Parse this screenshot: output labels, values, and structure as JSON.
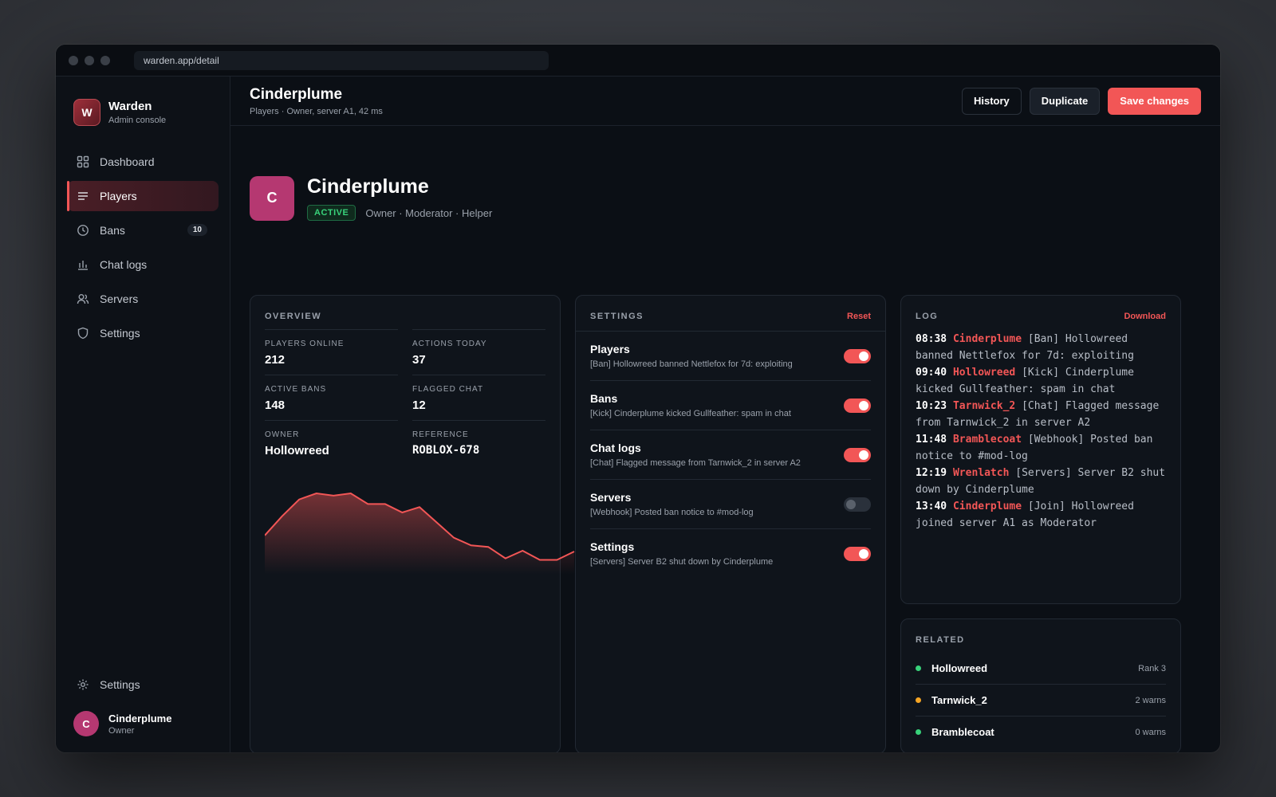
{
  "browser": {
    "url": "warden.app/detail"
  },
  "brand": {
    "logo_letter": "W",
    "name": "Warden",
    "subtitle": "Admin console"
  },
  "sidebar": {
    "items": [
      {
        "label": "Dashboard",
        "icon": "grid-icon"
      },
      {
        "label": "Players",
        "icon": "list-icon",
        "active": true
      },
      {
        "label": "Bans",
        "icon": "clock-icon",
        "badge": "10"
      },
      {
        "label": "Chat logs",
        "icon": "bar-chart-icon"
      },
      {
        "label": "Servers",
        "icon": "users-icon"
      },
      {
        "label": "Settings",
        "icon": "shield-icon"
      }
    ],
    "bottom_settings": "Settings",
    "user": {
      "initial": "C",
      "name": "Cinderplume",
      "role": "Owner"
    }
  },
  "header": {
    "title": "Cinderplume",
    "subtitle": "Players · Owner, server A1, 42 ms",
    "history_label": "History",
    "duplicate_label": "Duplicate",
    "save_label": "Save changes"
  },
  "profile": {
    "initial": "C",
    "name": "Cinderplume",
    "status": "ACTIVE",
    "roles": "Owner · Moderator · Helper"
  },
  "overview": {
    "heading": "OVERVIEW",
    "stats": [
      {
        "label": "PLAYERS ONLINE",
        "value": "212"
      },
      {
        "label": "ACTIONS TODAY",
        "value": "37"
      },
      {
        "label": "ACTIVE BANS",
        "value": "148"
      },
      {
        "label": "FLAGGED CHAT",
        "value": "12"
      },
      {
        "label": "OWNER",
        "value": "Hollowreed"
      },
      {
        "label": "REFERENCE",
        "value": "ROBLOX-678"
      }
    ],
    "sparkline": [
      0.45,
      0.7,
      0.92,
      1.0,
      0.97,
      1.0,
      0.86,
      0.86,
      0.75,
      0.82,
      0.62,
      0.42,
      0.32,
      0.3,
      0.15,
      0.25,
      0.13,
      0.13,
      0.24
    ]
  },
  "settings": {
    "heading": "SETTINGS",
    "reset_label": "Reset",
    "rows": [
      {
        "title": "Players",
        "desc": "[Ban] Hollowreed banned Nettlefox for 7d: exploiting",
        "on": true
      },
      {
        "title": "Bans",
        "desc": "[Kick] Cinderplume kicked Gullfeather: spam in chat",
        "on": true
      },
      {
        "title": "Chat logs",
        "desc": "[Chat] Flagged message from Tarnwick_2 in server A2",
        "on": true
      },
      {
        "title": "Servers",
        "desc": "[Webhook] Posted ban notice to #mod-log",
        "on": false
      },
      {
        "title": "Settings",
        "desc": "[Servers] Server B2 shut down by Cinderplume",
        "on": true
      }
    ]
  },
  "log": {
    "heading": "LOG",
    "download_label": "Download",
    "entries": [
      {
        "time": "08:38",
        "user": "Cinderplume",
        "text": "[Ban] Hollowreed banned Nettlefox for 7d: exploiting"
      },
      {
        "time": "09:40",
        "user": "Hollowreed",
        "text": "[Kick] Cinderplume kicked Gullfeather: spam in chat"
      },
      {
        "time": "10:23",
        "user": "Tarnwick_2",
        "text": "[Chat] Flagged message from Tarnwick_2 in server A2"
      },
      {
        "time": "11:48",
        "user": "Bramblecoat",
        "text": "[Webhook] Posted ban notice to #mod-log"
      },
      {
        "time": "12:19",
        "user": "Wrenlatch",
        "text": "[Servers] Server B2 shut down by Cinderplume"
      },
      {
        "time": "13:40",
        "user": "Cinderplume",
        "text": "[Join] Hollowreed joined server A1 as Moderator"
      }
    ]
  },
  "related": {
    "heading": "RELATED",
    "items": [
      {
        "name": "Hollowreed",
        "meta": "Rank 3",
        "color": "#38d27a"
      },
      {
        "name": "Tarnwick_2",
        "meta": "2 warns",
        "color": "#f5a524"
      },
      {
        "name": "Bramblecoat",
        "meta": "0 warns",
        "color": "#38d27a"
      }
    ]
  },
  "colors": {
    "accent": "#f25656",
    "success": "#38d27a",
    "warning": "#f5a524",
    "avatar": "#b53871"
  }
}
